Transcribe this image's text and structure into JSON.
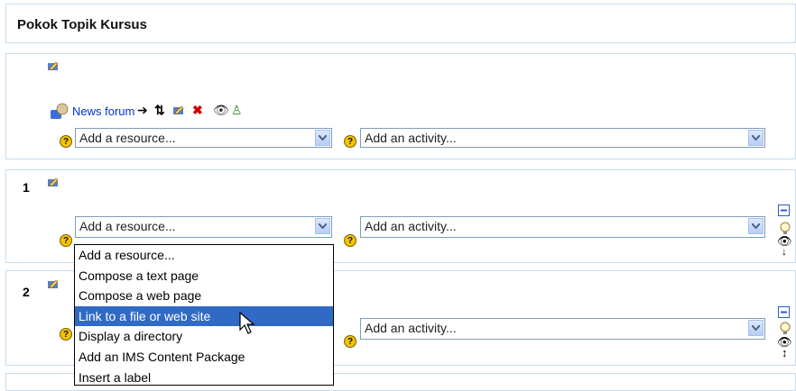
{
  "header": {
    "title": "Pokok Topik Kursus"
  },
  "section0": {
    "news_link": "News forum",
    "resource_select": "Add a resource...",
    "activity_select": "Add an activity..."
  },
  "section1": {
    "number": "1",
    "resource_select": "Add a resource...",
    "activity_select": "Add an activity..."
  },
  "section2": {
    "number": "2",
    "activity_select": "Add an activity..."
  },
  "dropdown": {
    "options": [
      "Add a resource...",
      "Compose a text page",
      "Compose a web page",
      "Link to a file or web site",
      "Display a directory",
      "Add an IMS Content Package",
      "Insert a label"
    ],
    "selected": "Link to a file or web site"
  },
  "icons": {
    "edit": "edit-icon",
    "forum": "forum-icon",
    "move": "move-arrow-icon",
    "updown": "updown-icon",
    "delete": "delete-icon",
    "visibility": "eye-icon",
    "groups": "groups-icon",
    "help": "help-icon",
    "collapse": "collapse-icon",
    "highlight": "lightbulb-icon"
  },
  "colors": {
    "accent": "#316ac5",
    "link": "#0033cc",
    "border": "#c8dcee"
  }
}
